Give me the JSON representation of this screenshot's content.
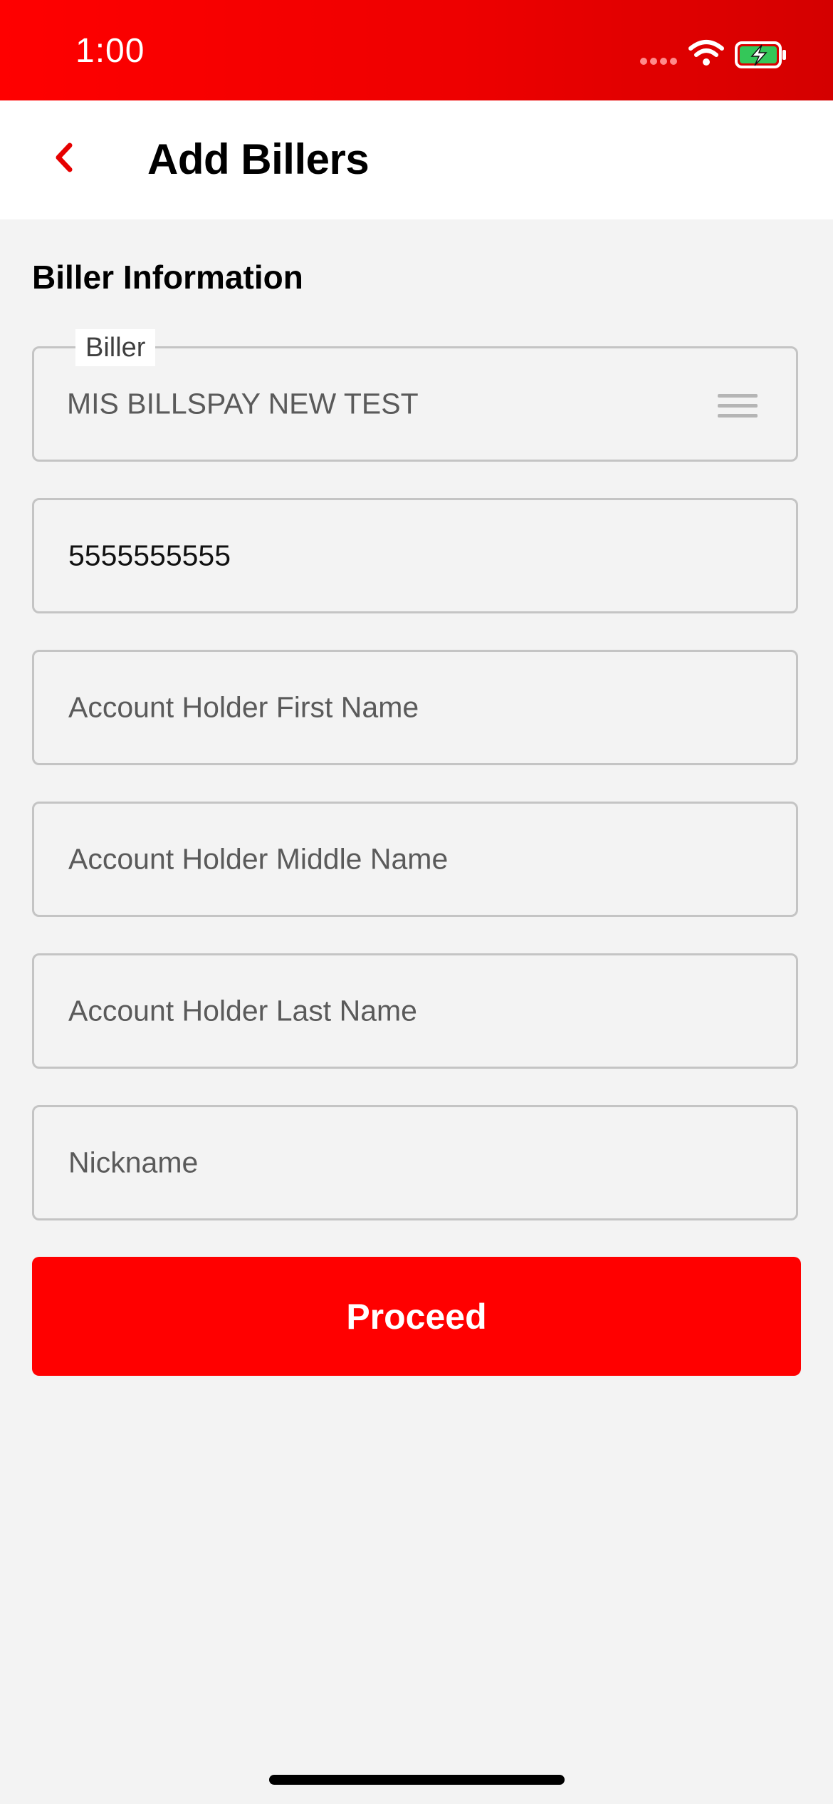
{
  "status_bar": {
    "time": "1:00",
    "icons": [
      "signal-dots-icon",
      "wifi-icon",
      "battery-charging-icon"
    ],
    "background_colors": [
      "#ff0000",
      "#d40000"
    ]
  },
  "header": {
    "title": "Add Billers",
    "back_icon": "chevron-left-icon"
  },
  "form": {
    "section_title": "Biller Information",
    "biller": {
      "label": "Biller",
      "value": "MIS BILLSPAY NEW TEST",
      "icon": "menu-icon"
    },
    "account_number": {
      "value": "5555555555"
    },
    "first_name": {
      "placeholder": "Account Holder First Name"
    },
    "middle_name": {
      "placeholder": "Account Holder Middle Name"
    },
    "last_name": {
      "placeholder": "Account Holder Last Name"
    },
    "nickname": {
      "placeholder": "Nickname"
    },
    "proceed_label": "Proceed"
  },
  "colors": {
    "accent": "#ff0000",
    "page_background": "#f3f3f3",
    "field_border": "#c4c4c4"
  }
}
